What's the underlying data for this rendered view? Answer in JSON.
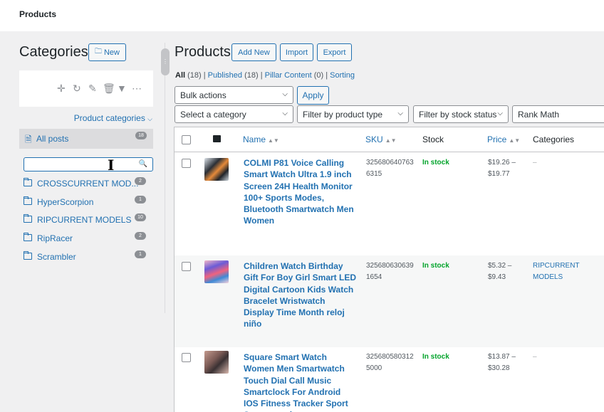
{
  "topbar": {
    "title": "Products"
  },
  "categories_panel": {
    "title": "Categories",
    "new_button": "New",
    "dropdown_link": "Product categories",
    "all_posts": {
      "label": "All posts",
      "count": "18"
    },
    "search_value": "",
    "folders": [
      {
        "name": "CROSSCURRENT MOD...",
        "count": "2"
      },
      {
        "name": "HyperScorpion",
        "count": "1"
      },
      {
        "name": "RIPCURRENT MODELS",
        "count": "10"
      },
      {
        "name": "RipRacer",
        "count": "2"
      },
      {
        "name": "Scrambler",
        "count": "1"
      }
    ]
  },
  "products": {
    "title": "Products",
    "buttons": {
      "add_new": "Add New",
      "import": "Import",
      "export": "Export"
    },
    "views": {
      "all": "All",
      "all_count": "(18)",
      "published": "Published",
      "published_count": "(18)",
      "pillar": "Pillar Content",
      "pillar_count": "(0)",
      "sorting": "Sorting",
      "sep": "|"
    },
    "bulk_actions": "Bulk actions",
    "apply": "Apply",
    "filters": {
      "category": "Select a category",
      "product_type": "Filter by product type",
      "stock_status": "Filter by stock status",
      "rank_math": "Rank Math"
    },
    "columns": {
      "name": "Name",
      "sku": "SKU",
      "stock": "Stock",
      "price": "Price",
      "categories": "Categories"
    },
    "rows": [
      {
        "name": "COLMI P81 Voice Calling Smart Watch Ultra 1.9 inch Screen 24H Health Monitor 100+ Sports Modes, Bluetooth Smartwatch Men Women",
        "sku": "3256806407636315",
        "stock": "In stock",
        "price_low": "$19.26 –",
        "price_high": "$19.77",
        "categories": "–"
      },
      {
        "name": "Children Watch Birthday Gift For Boy Girl Smart LED Digital Cartoon Kids Watch Bracelet Wristwatch Display Time Month reloj niño",
        "sku": "3256806306391654",
        "stock": "In stock",
        "price_low": "$5.32 –",
        "price_high": "$9.43",
        "categories": "RIPCURRENT MODELS"
      },
      {
        "name": "Square Smart Watch Women Men Smartwatch Touch Dial Call Music Smartclock For Android IOS Fitness Tracker Sport Smart-watch",
        "sku": "3256805803125000",
        "stock": "In stock",
        "price_low": "$13.87 –",
        "price_high": "$30.28",
        "categories": "–"
      }
    ]
  },
  "colors": {
    "link": "#2271b1",
    "in_stock": "#00a32a",
    "bg": "#f0f0f1"
  },
  "icons": [
    "new-folder-icon",
    "move-icon",
    "refresh-icon",
    "edit-icon",
    "trash-icon",
    "sort-icon",
    "more-icon",
    "document-icon",
    "search-icon",
    "folder-icon",
    "image-icon",
    "chevron-down-icon",
    "text-cursor-icon",
    "drag-handle-icon"
  ]
}
